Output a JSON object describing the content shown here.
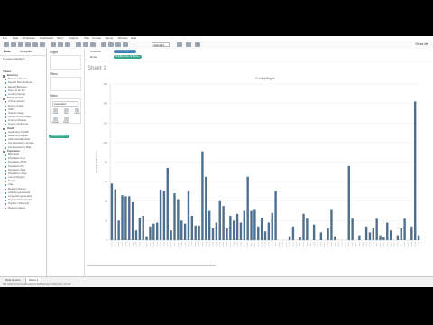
{
  "menu": [
    "File",
    "Data",
    "Worksheet",
    "Dashboard",
    "Story",
    "Analysis",
    "Map",
    "Format",
    "Server",
    "Window",
    "Help"
  ],
  "toolbar": {
    "fit_select": "Standard",
    "show_me": "Show Me"
  },
  "datapane": {
    "tabs": [
      "Data",
      "Analytics"
    ],
    "datasource": "Finance Indicators",
    "dimensions_header": "Tables",
    "fields": [
      {
        "kind": "folder",
        "label": "Business"
      },
      {
        "kind": "dim",
        "label": "Business Tax rate"
      },
      {
        "kind": "dim",
        "label": "Days to Start Business"
      },
      {
        "kind": "dim",
        "label": "Ease of Business"
      },
      {
        "kind": "dim",
        "label": "Hours to do Tax"
      },
      {
        "kind": "dim",
        "label": "Lending Interest"
      },
      {
        "kind": "folder",
        "label": "Development"
      },
      {
        "kind": "dim",
        "label": "CO2 Emissions"
      },
      {
        "kind": "dim",
        "label": "Energy Usage"
      },
      {
        "kind": "dim",
        "label": "GDP"
      },
      {
        "kind": "dim",
        "label": "Internet Usage"
      },
      {
        "kind": "dim",
        "label": "Mobile Phone Usage"
      },
      {
        "kind": "dim",
        "label": "Tourism Inbound"
      },
      {
        "kind": "dim",
        "label": "Tourism Outbound"
      },
      {
        "kind": "folder",
        "label": "Health"
      },
      {
        "kind": "dim",
        "label": "Health Exp % GDP"
      },
      {
        "kind": "dim",
        "label": "Health Exp/Capita"
      },
      {
        "kind": "dim",
        "label": "Infant Mortality Rate"
      },
      {
        "kind": "dim",
        "label": "Life Expectancy Female"
      },
      {
        "kind": "dim",
        "label": "Life Expectancy Male"
      },
      {
        "kind": "folder",
        "label": "Population"
      },
      {
        "kind": "dim",
        "label": "Birth Rate"
      },
      {
        "kind": "dim",
        "label": "Population 0-14"
      },
      {
        "kind": "dim",
        "label": "Population 15-64"
      },
      {
        "kind": "dim",
        "label": "Population 65+"
      },
      {
        "kind": "dim",
        "label": "Population Total"
      },
      {
        "kind": "dim",
        "label": "Population Urban"
      },
      {
        "kind": "dim",
        "label": "Country/Region"
      },
      {
        "kind": "dim",
        "label": "Region"
      },
      {
        "kind": "dim",
        "label": "Year"
      },
      {
        "kind": "dim",
        "label": "Measure Names"
      },
      {
        "kind": "mea",
        "label": "Latitude (generated)"
      },
      {
        "kind": "mea",
        "label": "Longitude (generated)"
      },
      {
        "kind": "mea",
        "label": "Migrated Data (Count)"
      },
      {
        "kind": "mea",
        "label": "Number of Records"
      },
      {
        "kind": "mea",
        "label": "Measure Values"
      }
    ]
  },
  "cards": {
    "pages": "Pages",
    "filters": "Filters",
    "marks": "Marks",
    "mark_type": "Automatic",
    "mark_buttons": [
      "Color",
      "Size",
      "Label",
      "Detail",
      "Tooltip"
    ],
    "mark_pill": "SUM(Number...)"
  },
  "shelves": {
    "columns_label": "Columns",
    "rows_label": "Rows",
    "columns_pill": "Country/Region ▾ ▸",
    "rows_pill": "SUM(Number of Recor..."
  },
  "sheet": {
    "title": "Sheet 1"
  },
  "chart_data": {
    "type": "bar",
    "title": "Country/Region",
    "ylabel": "Number of Records",
    "xlabel": "",
    "ylim": [
      0,
      160
    ],
    "yticks": [
      0,
      20,
      40,
      60,
      80,
      100,
      120,
      140,
      160
    ],
    "bar_color": "#4f6f8f",
    "grid": true,
    "values": [
      58,
      52,
      20,
      46,
      45,
      45,
      39,
      10,
      23,
      25,
      4,
      14,
      17,
      18,
      52,
      50,
      74,
      10,
      48,
      42,
      20,
      17,
      50,
      25,
      15,
      15,
      91,
      65,
      30,
      12,
      18,
      40,
      35,
      12,
      25,
      20,
      27,
      18,
      30,
      65,
      30,
      31,
      14,
      23,
      9,
      18,
      28,
      50,
      0,
      0,
      0,
      4,
      14,
      0,
      3,
      27,
      22,
      0,
      16,
      0,
      8,
      0,
      12,
      31,
      4,
      0,
      0,
      0,
      76,
      22,
      0,
      5,
      0,
      14,
      8,
      13,
      22,
      5,
      3,
      18,
      10,
      0,
      5,
      12,
      22,
      0,
      14,
      142,
      5
    ]
  },
  "statusbar": {
    "tabs": [
      "Data Source",
      "Sheet 1"
    ],
    "text": "208 marks   1 row by 208 columns   SUM(Number of Records): 13,515"
  }
}
